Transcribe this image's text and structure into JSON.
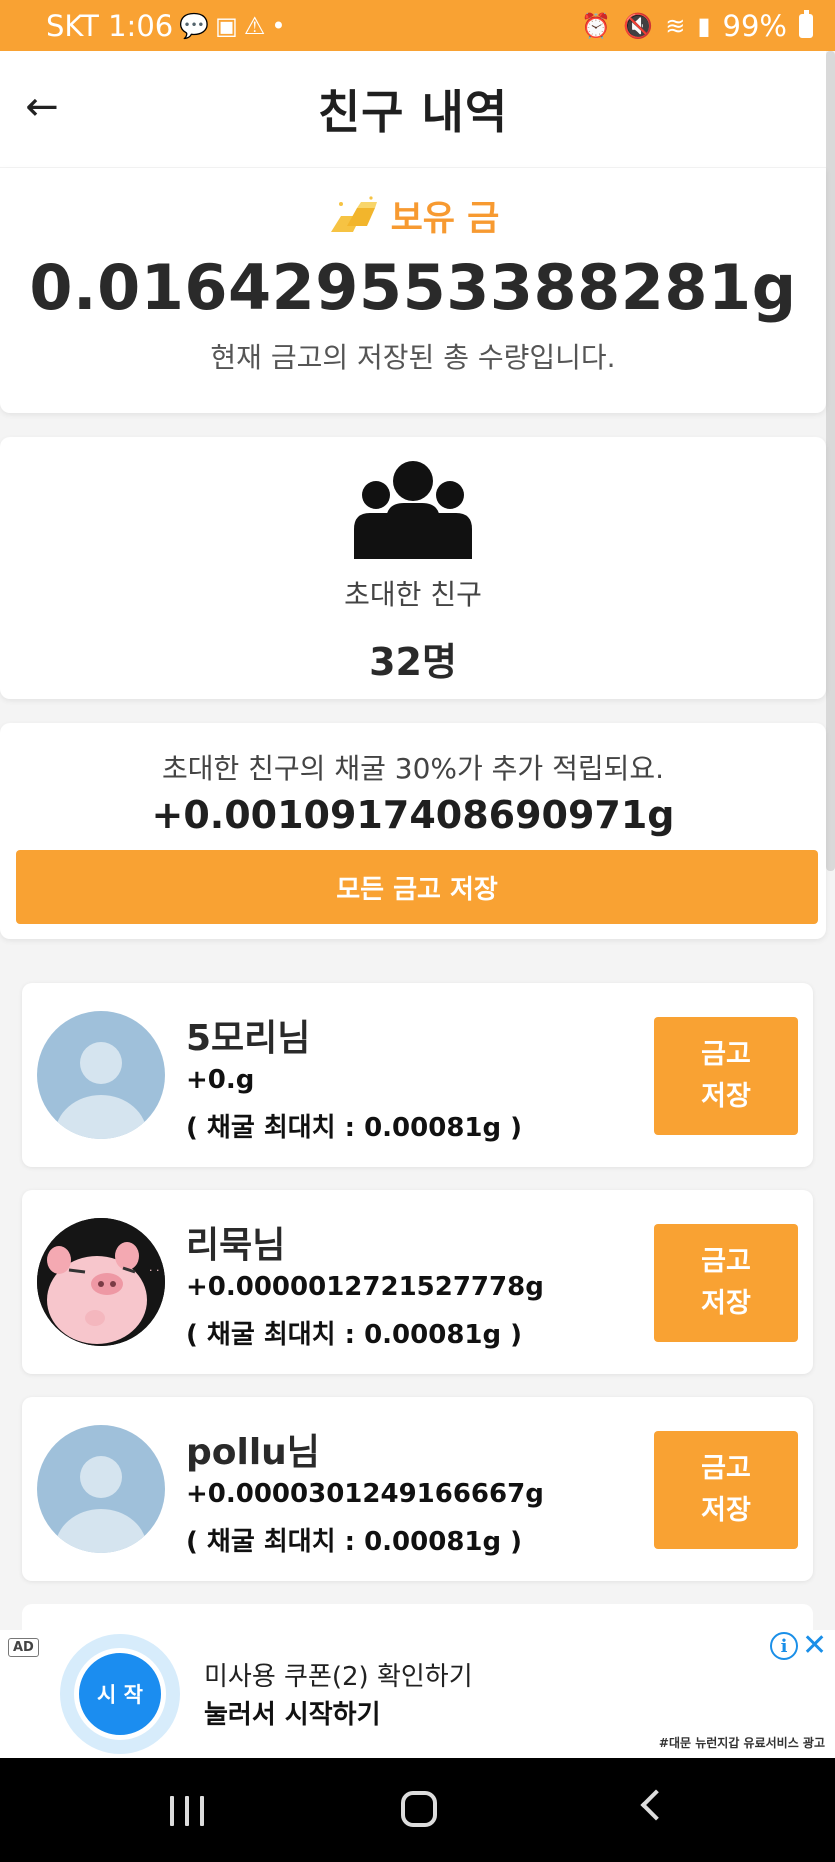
{
  "status_bar": {
    "carrier_time": "SKT 1:06",
    "battery": "99%",
    "left_icons": [
      "talk-icon",
      "calendar-icon",
      "warning-icon",
      "dot-icon"
    ],
    "right_icons": [
      "alarm-icon",
      "mute-icon",
      "wifi-icon",
      "signal-icon",
      "battery-icon"
    ]
  },
  "header": {
    "title": "친구 내역",
    "back_icon": "arrow-left-icon"
  },
  "holdings": {
    "label": "보유 금",
    "amount": "0.016429553388281g",
    "description": "현재 금고의 저장된 총 수량입니다."
  },
  "friends": {
    "label": "초대한 친구",
    "count": "32명"
  },
  "bonus": {
    "description": "초대한 친구의 채굴 30%가 추가 적립되요.",
    "amount": "+0.0010917408690971g",
    "save_all_label": "모든 금고 저장"
  },
  "friend_list": [
    {
      "name": "5모리님",
      "amount": "+0.g",
      "max": "( 채굴 최대치 : 0.00081g )",
      "btn_line1": "금고",
      "btn_line2": "저장"
    },
    {
      "name": "리묵님",
      "amount": "+0.0000012721527778g",
      "max": "( 채굴 최대치 : 0.00081g )",
      "btn_line1": "금고",
      "btn_line2": "저장"
    },
    {
      "name": "pollu님",
      "amount": "+0.0000301249166667g",
      "max": "( 채굴 최대치 : 0.00081g )",
      "btn_line1": "금고",
      "btn_line2": "저장"
    }
  ],
  "ad": {
    "tag": "AD",
    "start_label": "시 작",
    "line1": "미사용 쿠폰(2) 확인하기",
    "line2": "눌러서 시작하기",
    "footer": "#대문 뉴런지갑 유료서비스 광고"
  },
  "colors": {
    "accent": "#f9a233",
    "gold_label": "#f79a31",
    "ad_blue": "#1b8df0"
  }
}
